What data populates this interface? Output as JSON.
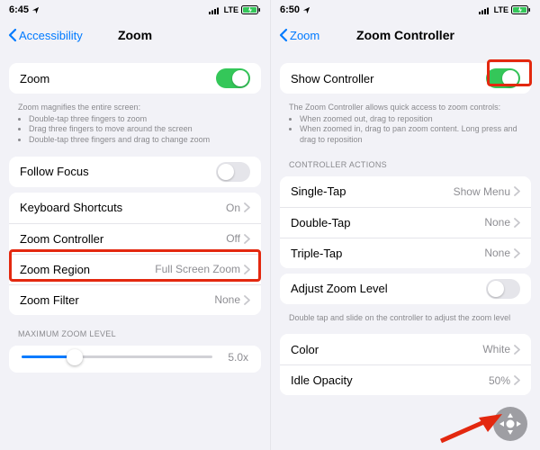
{
  "colors": {
    "accent_blue": "#007aff",
    "toggle_green": "#34c759",
    "highlight_red": "#e3280f"
  },
  "left": {
    "status": {
      "time": "6:45",
      "carrier": "LTE"
    },
    "nav": {
      "back": "Accessibility",
      "title": "Zoom"
    },
    "zoom_row": {
      "label": "Zoom",
      "on": true
    },
    "zoom_note": {
      "header": "Zoom magnifies the entire screen:",
      "bullets": [
        "Double-tap three fingers to zoom",
        "Drag three fingers to move around the screen",
        "Double-tap three fingers and drag to change zoom"
      ]
    },
    "follow_focus": {
      "label": "Follow Focus",
      "on": false
    },
    "links": [
      {
        "label": "Keyboard Shortcuts",
        "value": "On"
      },
      {
        "label": "Zoom Controller",
        "value": "Off"
      },
      {
        "label": "Zoom Region",
        "value": "Full Screen Zoom"
      },
      {
        "label": "Zoom Filter",
        "value": "None"
      }
    ],
    "max_header": "MAXIMUM ZOOM LEVEL",
    "slider": {
      "value_text": "5.0x",
      "fill_pct": 28
    }
  },
  "right": {
    "status": {
      "time": "6:50",
      "carrier": "LTE"
    },
    "nav": {
      "back": "Zoom",
      "title": "Zoom Controller"
    },
    "show_controller": {
      "label": "Show Controller",
      "on": true
    },
    "show_note": {
      "header": "The Zoom Controller allows quick access to zoom controls:",
      "bullets": [
        "When zoomed out, drag to reposition",
        "When zoomed in, drag to pan zoom content. Long press and drag to reposition"
      ]
    },
    "actions_header": "CONTROLLER ACTIONS",
    "actions": [
      {
        "label": "Single-Tap",
        "value": "Show Menu"
      },
      {
        "label": "Double-Tap",
        "value": "None"
      },
      {
        "label": "Triple-Tap",
        "value": "None"
      }
    ],
    "adjust": {
      "label": "Adjust Zoom Level",
      "on": false
    },
    "adjust_note": "Double tap and slide on the controller to adjust the zoom level",
    "appearance": [
      {
        "label": "Color",
        "value": "White"
      },
      {
        "label": "Idle Opacity",
        "value": "50%"
      }
    ]
  }
}
